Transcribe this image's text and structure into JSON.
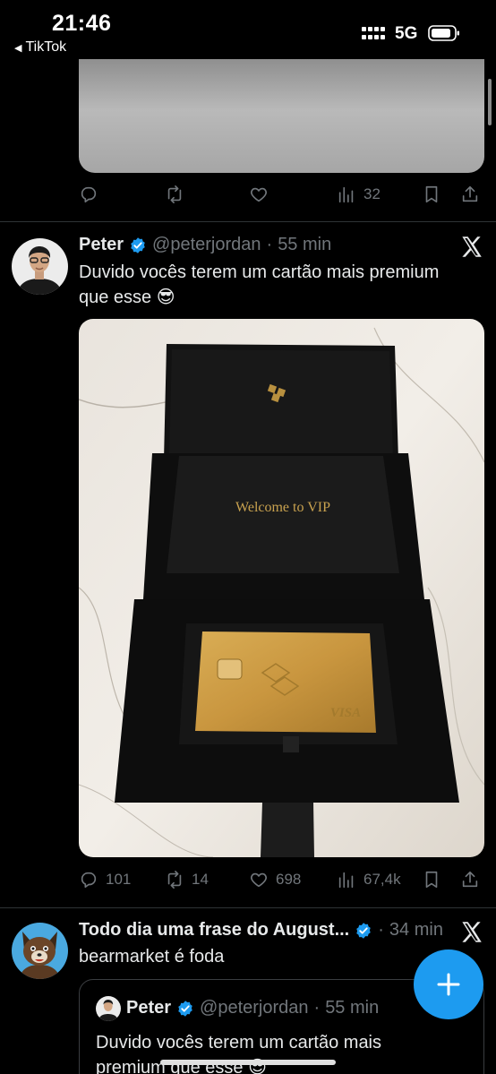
{
  "status_bar": {
    "time": "21:46",
    "back_app": "TikTok",
    "network": "5G"
  },
  "prev_tweet": {
    "views": "32"
  },
  "tweet": {
    "name": "Peter",
    "handle": "@peterjordan",
    "separator": "·",
    "time": "55 min",
    "text_line1": "Duvido vocês terem um cartão mais premium",
    "text_line2": "que esse 😎",
    "photo": {
      "box_text": "Welcome to VIP",
      "card_brand": "VISA"
    },
    "stats": {
      "replies": "101",
      "reposts": "14",
      "likes": "698",
      "views": "67,4k"
    }
  },
  "tweet2": {
    "name": "Todo dia uma frase do August...",
    "separator": "·",
    "time": "34 min",
    "text": "bearmarket é foda",
    "quote": {
      "name": "Peter",
      "handle": "@peterjordan",
      "separator": "·",
      "time": "55 min",
      "text_line1": "Duvido vocês terem um cartão mais",
      "text_line2": "premium que esse 😎"
    }
  },
  "icons": {
    "reply": "reply-icon",
    "repost": "repost-icon",
    "like": "heart-icon",
    "views": "views-icon",
    "bookmark": "bookmark-icon",
    "share": "share-icon",
    "verified": "verified-badge-icon",
    "x": "x-logo-icon",
    "compose": "plus-icon"
  },
  "colors": {
    "background": "#000000",
    "text": "#e7e9ea",
    "muted": "#71767b",
    "accent": "#1d9bf0",
    "divider": "#2f3336"
  }
}
